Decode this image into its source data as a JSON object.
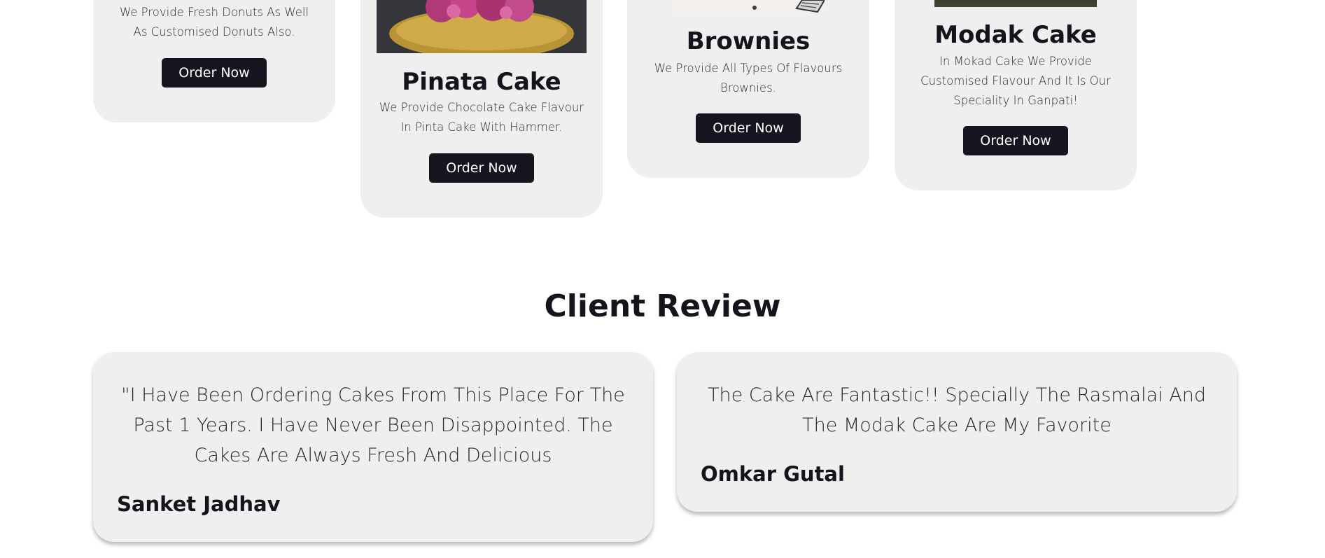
{
  "products": [
    {
      "name": "",
      "description": "We Provide Fresh Donuts As Well As Customised Donuts Also.",
      "button": "Order Now"
    },
    {
      "name": "Pinata Cake",
      "description": "We Provide Chocolate Cake Flavour In Pinta Cake With Hammer.",
      "button": "Order Now"
    },
    {
      "name": "Brownies",
      "description": "We Provide All Types Of Flavours Brownies.",
      "button": "Order Now"
    },
    {
      "name": "Modak Cake",
      "description": "In Mokad Cake We Provide Customised Flavour And It Is Our Speciality In Ganpati!",
      "button": "Order Now"
    }
  ],
  "reviews": {
    "title": "Client Review",
    "items": [
      {
        "quote": "\"I Have Been Ordering Cakes From This Place For The Past 1 Years. I Have Never Been Disappointed. The Cakes Are Always Fresh And Delicious",
        "author": "Sanket Jadhav"
      },
      {
        "quote": "The Cake Are Fantastic!! Specially The Rasmalai And The Modak Cake Are My Favorite",
        "author": "Omkar Gutal"
      }
    ]
  }
}
